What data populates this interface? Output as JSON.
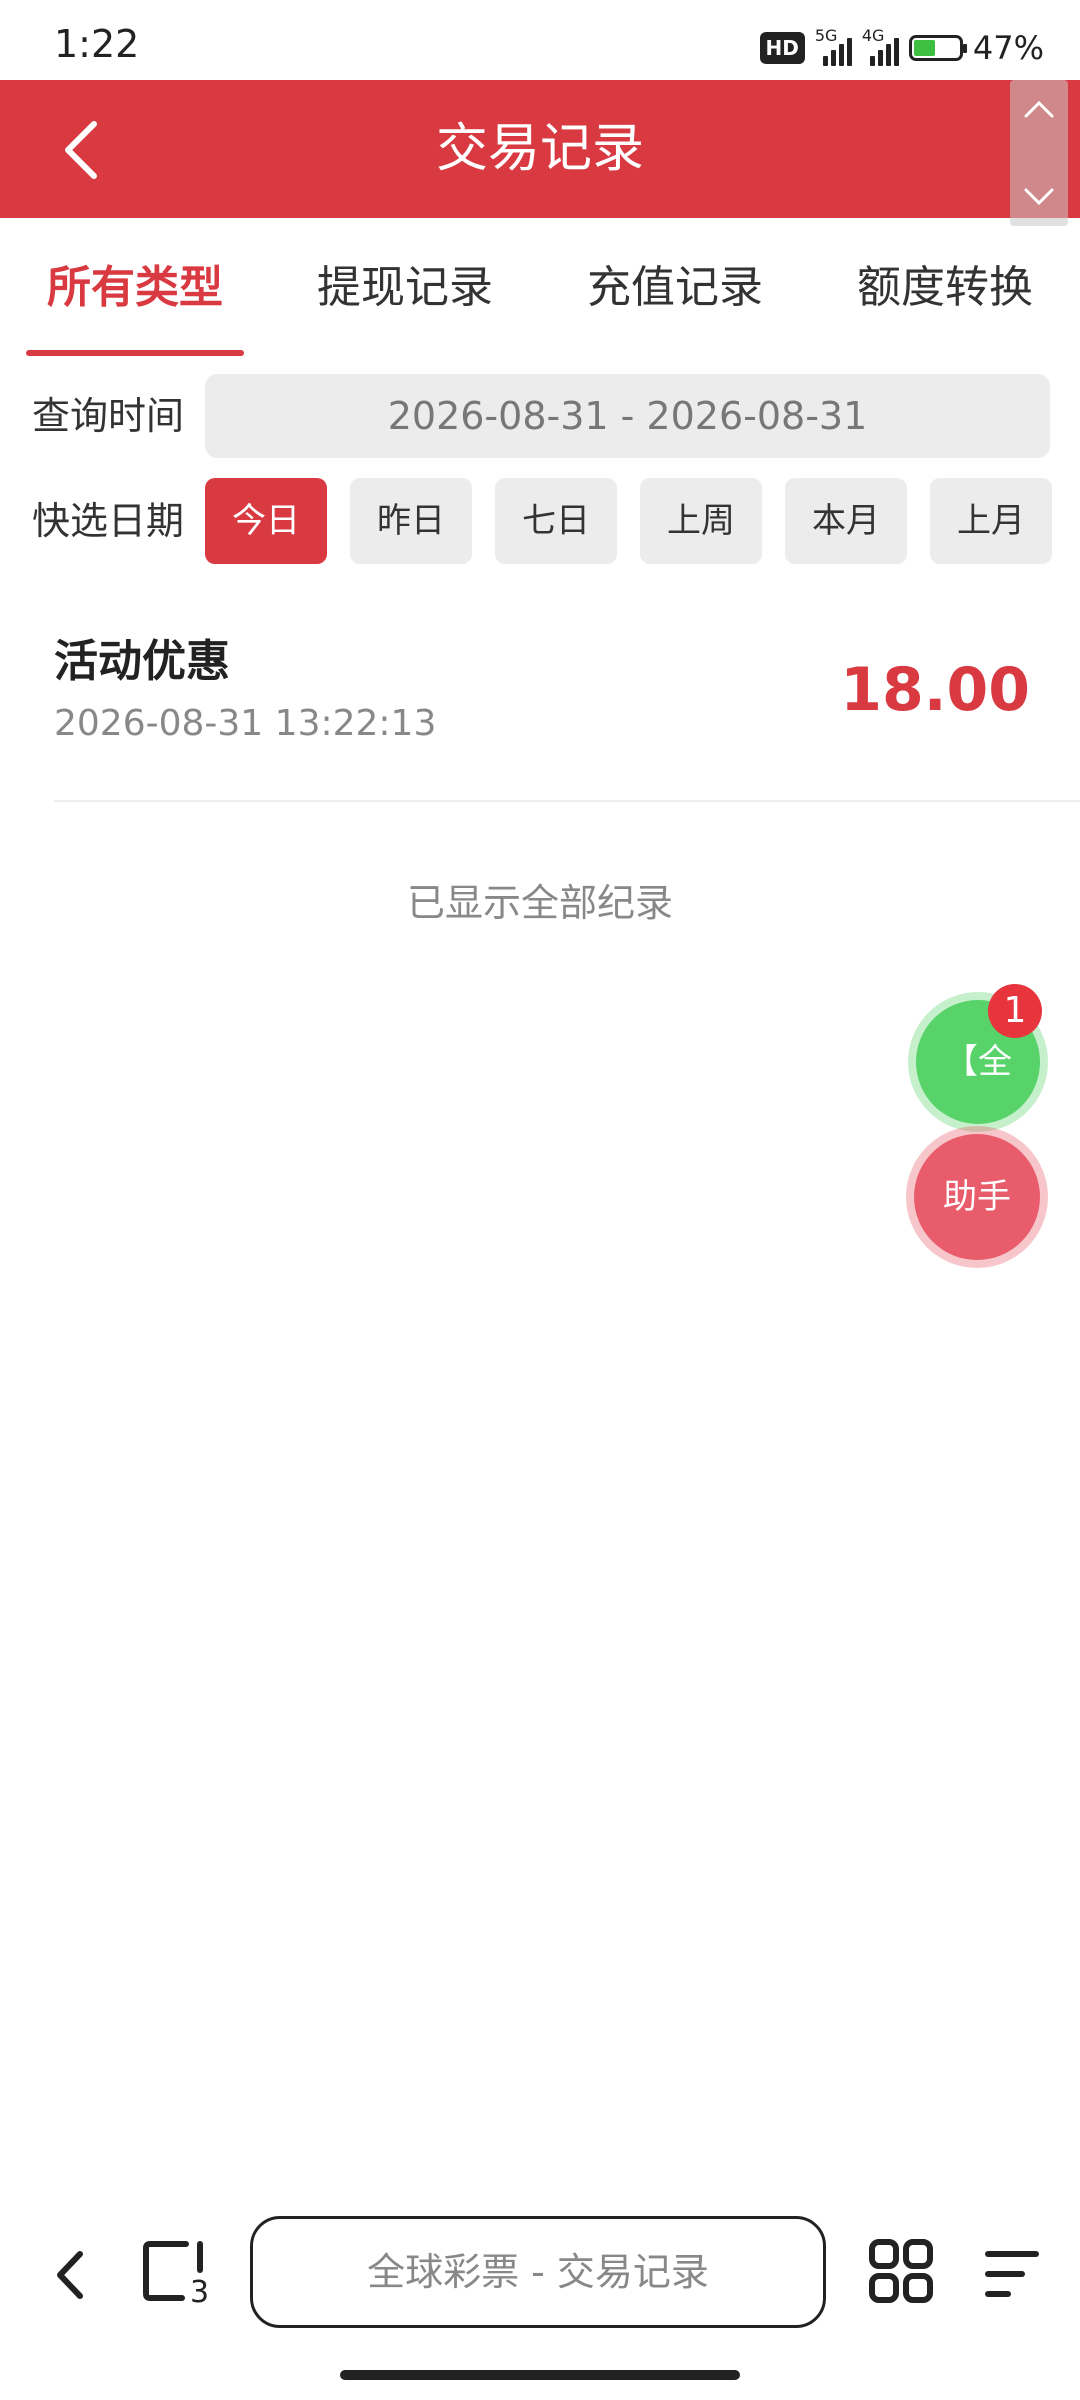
{
  "status_bar": {
    "time": "1:22",
    "hd_label": "HD",
    "net1": "5G",
    "net2": "4G",
    "battery_level": 0.47,
    "battery": "47%"
  },
  "header": {
    "title": "交易记录",
    "back_icon": "chevron-left-icon"
  },
  "tabs": [
    {
      "label": "所有类型",
      "active": true
    },
    {
      "label": "提现记录",
      "active": false
    },
    {
      "label": "充值记录",
      "active": false
    },
    {
      "label": "额度转换",
      "active": false
    }
  ],
  "filters": {
    "query_label": "查询时间",
    "date_range": "2026-08-31 - 2026-08-31",
    "quick_label": "快选日期",
    "quick_options": [
      "今日",
      "昨日",
      "七日",
      "上周",
      "本月",
      "上月"
    ],
    "selected_quick": "今日"
  },
  "records": [
    {
      "title": "活动优惠",
      "time": "2026-08-31 13:22:13",
      "amount": "18.00"
    }
  ],
  "list_end_text": "已显示全部纪录",
  "floating": {
    "green_label": "【全",
    "badge_count": "1",
    "assistant_label": "助手"
  },
  "browser_bar": {
    "url_text": "全球彩票 - 交易记录",
    "tab_count": "3"
  },
  "colors": {
    "brand_red": "#d93a42",
    "float_green": "#58d36a",
    "float_red": "#e85c6b"
  }
}
